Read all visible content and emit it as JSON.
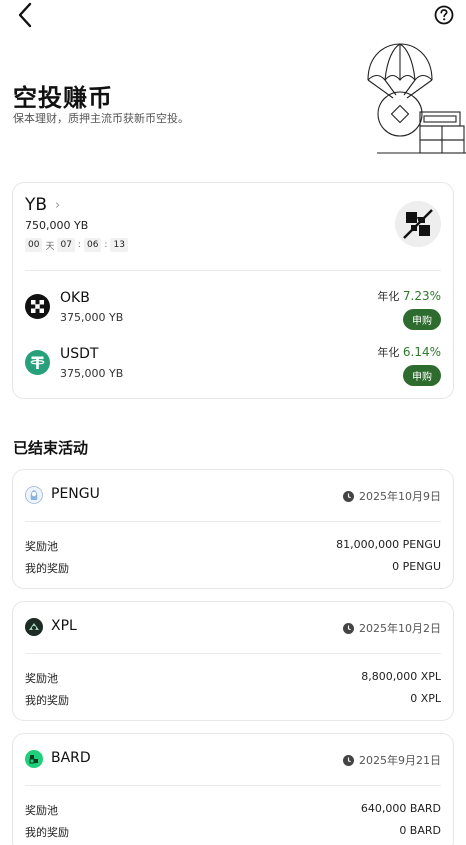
{
  "hero": {
    "title": "空投赚币",
    "subtitle": "保本理财，质押主流币获新币空投。"
  },
  "campaign": {
    "token": "YB",
    "amount": "750,000 YB",
    "countdown": {
      "days": "00",
      "days_unit": "天",
      "hours": "07",
      "minutes": "06",
      "seconds": "13"
    },
    "assets": [
      {
        "name": "OKB",
        "pool": "375,000 YB",
        "apy_label": "年化",
        "apy_value": "7.23%",
        "button": "申购"
      },
      {
        "name": "USDT",
        "pool": "375,000 YB",
        "apy_label": "年化",
        "apy_value": "6.14%",
        "button": "申购"
      }
    ]
  },
  "ended": {
    "title": "已结束活动",
    "items": [
      {
        "name": "PENGU",
        "date": "2025年10月9日",
        "pool_label": "奖励池",
        "pool": "81,000,000 PENGU",
        "reward_label": "我的奖励",
        "reward": "0 PENGU"
      },
      {
        "name": "XPL",
        "date": "2025年10月2日",
        "pool_label": "奖励池",
        "pool": "8,800,000 XPL",
        "reward_label": "我的奖励",
        "reward": "0 XPL"
      },
      {
        "name": "BARD",
        "date": "2025年9月21日",
        "pool_label": "奖励池",
        "pool": "640,000 BARD",
        "reward_label": "我的奖励",
        "reward": "0 BARD"
      }
    ]
  },
  "colors": {
    "accent_green": "#2d7a2b",
    "button_green": "#2e6b2e",
    "usdt_teal": "#26a17b",
    "bard_green": "#1fd07a"
  },
  "icons": {
    "back": "chevron-left-icon",
    "help": "question-circle-icon",
    "clock": "clock-icon"
  }
}
